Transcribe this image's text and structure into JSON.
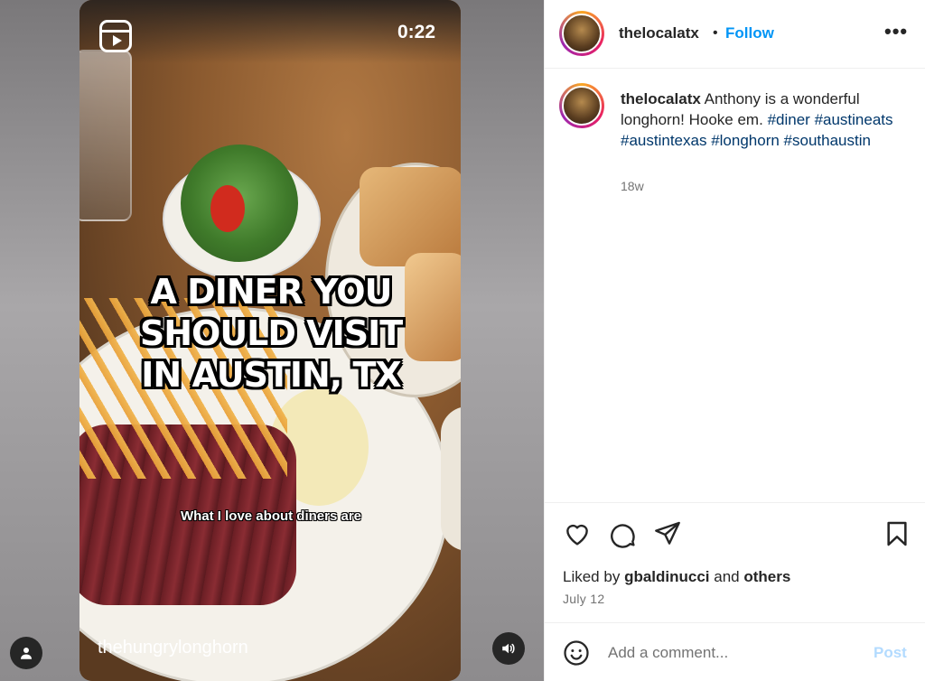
{
  "video": {
    "timer": "0:22",
    "caption_lines": [
      "A DINER YOU",
      "SHOULD VISIT",
      "IN AUSTIN, TX"
    ],
    "subtitle": "What I love about diners are",
    "audio_credit": "thehungrylonghorn"
  },
  "header": {
    "username": "thelocalatx",
    "separator": "•",
    "follow_label": "Follow",
    "more_label": "•••"
  },
  "post": {
    "username": "thelocalatx",
    "text": "Anthony is a wonderful longhorn! Hooke em.",
    "hashtags": [
      "#diner",
      "#austineats",
      "#austintexas",
      "#longhorn",
      "#southaustin"
    ],
    "age": "18w"
  },
  "engagement": {
    "liked_by_prefix": "Liked by",
    "liked_by_user": "gbaldinucci",
    "liked_by_and": "and",
    "liked_by_others": "others",
    "date": "July 12"
  },
  "comment": {
    "placeholder": "Add a comment...",
    "post_label": "Post"
  },
  "icons": {
    "reel": "reel-icon",
    "like": "heart-icon",
    "comment": "comment-icon",
    "share": "send-icon",
    "save": "bookmark-icon",
    "emoji": "emoji-icon",
    "sound": "speaker-icon",
    "user_tags": "person-icon"
  },
  "colors": {
    "accent": "#0095f6",
    "hashtag": "#00376b",
    "post_disabled": "#b3dbff"
  }
}
